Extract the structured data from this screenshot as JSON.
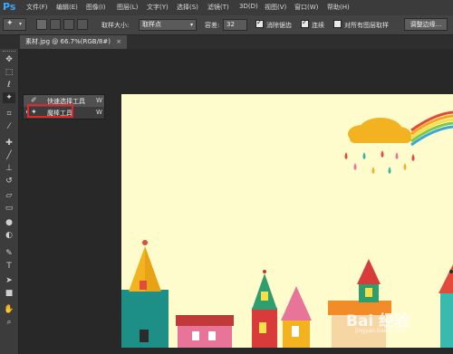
{
  "app": {
    "logo": "Ps"
  },
  "menu": [
    "文件(F)",
    "编辑(E)",
    "图像(I)",
    "图层(L)",
    "文字(Y)",
    "选择(S)",
    "滤镜(T)",
    "3D(D)",
    "视图(V)",
    "窗口(W)",
    "帮助(H)"
  ],
  "options": {
    "sample_size_label": "取样大小:",
    "sample_size_value": "取样点",
    "tolerance_label": "容差:",
    "tolerance_value": "32",
    "antialias_label": "消除锯齿",
    "antialias_checked": true,
    "contiguous_label": "连续",
    "contiguous_checked": true,
    "all_layers_label": "对所有图层取样",
    "all_layers_checked": false,
    "refine_edge_label": "调整边缘..."
  },
  "document": {
    "tab_title": "素材.jpg @ 66.7%(RGB/8#)",
    "close_glyph": "×"
  },
  "flyout": {
    "items": [
      {
        "label": "快速选择工具",
        "shortcut": "W",
        "icon": "quick-selection-icon"
      },
      {
        "label": "魔棒工具",
        "shortcut": "W",
        "icon": "magic-wand-icon",
        "active": true
      }
    ]
  },
  "tools": [
    "move-icon",
    "marquee-icon",
    "lasso-icon",
    "magic-wand-icon",
    "crop-icon",
    "eyedropper-icon",
    "healing-brush-icon",
    "brush-icon",
    "clone-stamp-icon",
    "history-brush-icon",
    "eraser-icon",
    "gradient-icon",
    "blur-icon",
    "dodge-icon",
    "pen-icon",
    "type-icon",
    "path-selection-icon",
    "rectangle-shape-icon",
    "hand-icon",
    "zoom-icon"
  ],
  "watermark": {
    "text": "Bai 经验",
    "sub": "jingyan.baidu.com"
  },
  "colors": {
    "accent": "#39a8ff",
    "highlight": "#e8232a",
    "canvas_bg": "#fefbcd"
  }
}
